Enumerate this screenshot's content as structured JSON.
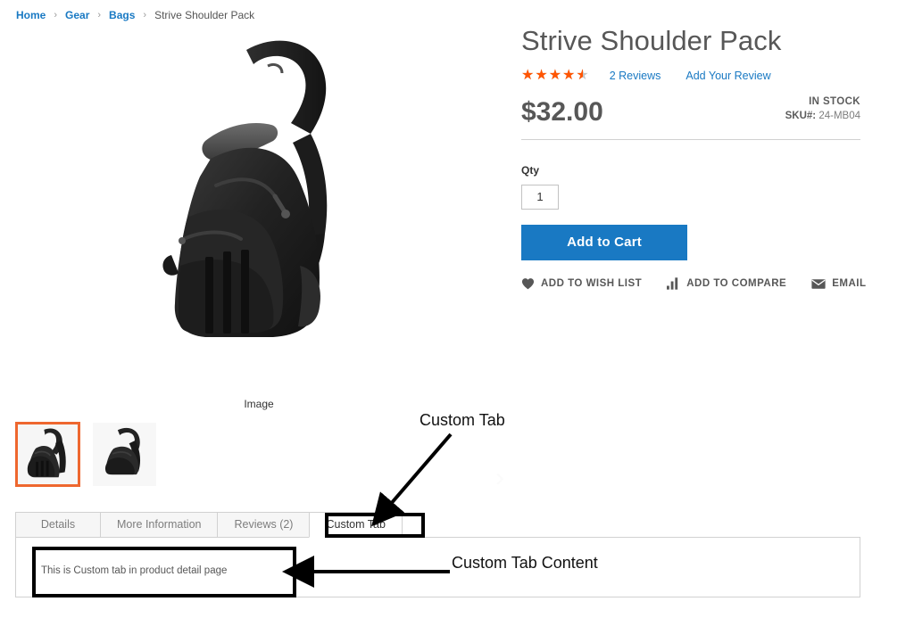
{
  "breadcrumbs": {
    "separator": "›",
    "items": [
      {
        "label": "Home",
        "link": true
      },
      {
        "label": "Gear",
        "link": true
      },
      {
        "label": "Bags",
        "link": true
      },
      {
        "label": "Strive Shoulder Pack",
        "link": false
      }
    ]
  },
  "gallery": {
    "caption": "Image",
    "next_arrow": "›",
    "thumbnails": [
      {
        "name": "thumbnail-1",
        "selected": true
      },
      {
        "name": "thumbnail-2",
        "selected": false
      }
    ]
  },
  "product": {
    "title": "Strive Shoulder Pack",
    "rating_value": 4.5,
    "rating_max": 5,
    "rating_percent": "90%",
    "stars_glyphs": "★★★★★",
    "reviews_link": "2  Reviews",
    "add_review_link": "Add Your Review",
    "price": "$32.00",
    "stock_status": "IN STOCK",
    "sku_label": "SKU#:",
    "sku_value": "24-MB04",
    "qty_label": "Qty",
    "qty_value": "1",
    "add_to_cart_label": "Add to Cart"
  },
  "actions": [
    {
      "label": "ADD TO WISH LIST",
      "icon": "heart-icon"
    },
    {
      "label": "ADD TO COMPARE",
      "icon": "bar-chart-icon"
    },
    {
      "label": "EMAIL",
      "icon": "envelope-icon"
    }
  ],
  "tabs": {
    "items": [
      {
        "label": "Details",
        "active": false
      },
      {
        "label": "More Information",
        "active": false
      },
      {
        "label": "Reviews (2)",
        "active": false
      },
      {
        "label": "Custom Tab",
        "active": true
      }
    ],
    "panel_text": "This is Custom tab in product detail page"
  },
  "annotations": [
    {
      "name": "custom-tab-annotation",
      "label": "Custom Tab"
    },
    {
      "name": "custom-tab-content-annotation",
      "label": "Custom Tab Content"
    }
  ],
  "colors": {
    "accent_blue": "#1979c3",
    "star_orange": "#ff5501",
    "thumb_selected": "#ee672f",
    "text_dark": "#575757",
    "border_gray": "#d1d1d1"
  }
}
